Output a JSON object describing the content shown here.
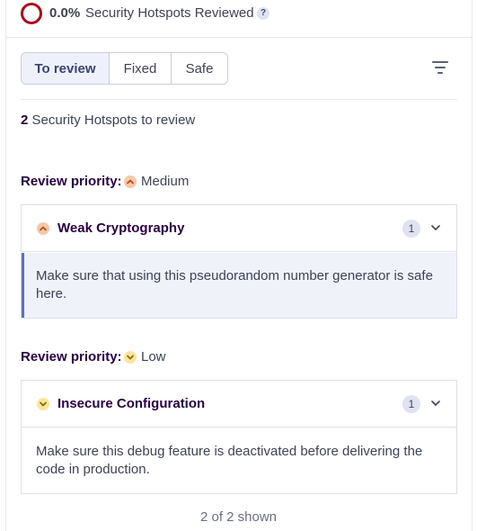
{
  "header": {
    "percent": "0.0%",
    "reviewed_label": "Security Hotspots Reviewed",
    "help": "?"
  },
  "tabs": [
    {
      "label": "To review",
      "active": true
    },
    {
      "label": "Fixed",
      "active": false
    },
    {
      "label": "Safe",
      "active": false
    }
  ],
  "summary": {
    "count": "2",
    "text": "Security Hotspots to review"
  },
  "groups": [
    {
      "priority_label": "Review priority:",
      "priority": "Medium",
      "icon": "chevron-up-icon",
      "color": "#f6c9a8",
      "icon_color": "#c4491b",
      "category": "Weak Cryptography",
      "count": "1",
      "message": "Make sure that using this pseudorandom number generator is safe here."
    },
    {
      "priority_label": "Review priority:",
      "priority": "Low",
      "icon": "chevron-down-icon",
      "color": "#fbe6a0",
      "icon_color": "#8a6d00",
      "category": "Insecure Configuration",
      "count": "1",
      "message": "Make sure this debug feature is deactivated before delivering the code in production."
    }
  ],
  "footer": {
    "shown": "2 of 2 shown"
  },
  "colors": {
    "progress_ring": "#a80c18",
    "active_tab": "#eef1fa",
    "selected_accent": "#5d6cd0"
  }
}
